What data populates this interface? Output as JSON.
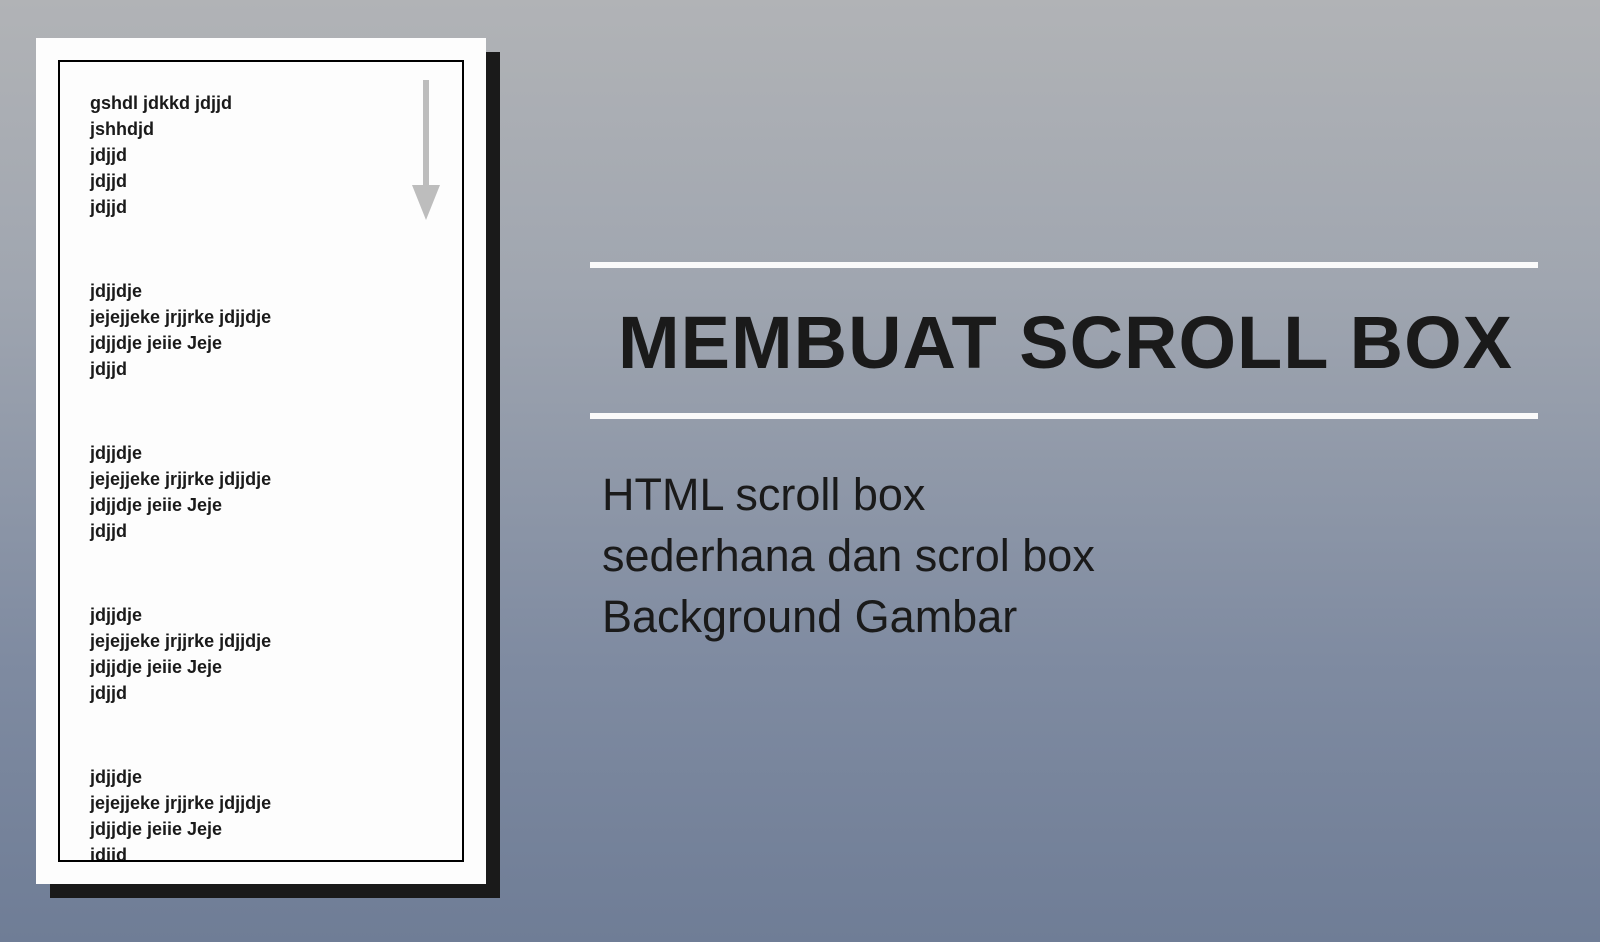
{
  "scrollbox": {
    "blocks": [
      [
        "gshdl jdkkd jdjjd",
        "jshhdjd",
        "jdjjd",
        "jdjjd",
        "jdjjd"
      ],
      [
        "jdjjdje",
        "jejejjeke jrjjrke jdjjdje",
        "jdjjdje jeiie Jeje",
        "jdjjd"
      ],
      [
        "jdjjdje",
        "jejejjeke jrjjrke jdjjdje",
        "jdjjdje jeiie Jeje",
        "jdjjd"
      ],
      [
        "jdjjdje",
        "jejejjeke jrjjrke jdjjdje",
        "jdjjdje jeiie Jeje",
        "jdjjd"
      ],
      [
        "jdjjdje",
        "jejejjeke jrjjrke jdjjdje",
        "jdjjdje jeiie Jeje",
        "jdjjd"
      ]
    ]
  },
  "heading": {
    "title": "MEMBUAT SCROLL BOX",
    "subtitle_lines": [
      "HTML scroll box",
      "sederhana dan scrol box",
      "Background Gambar"
    ]
  }
}
